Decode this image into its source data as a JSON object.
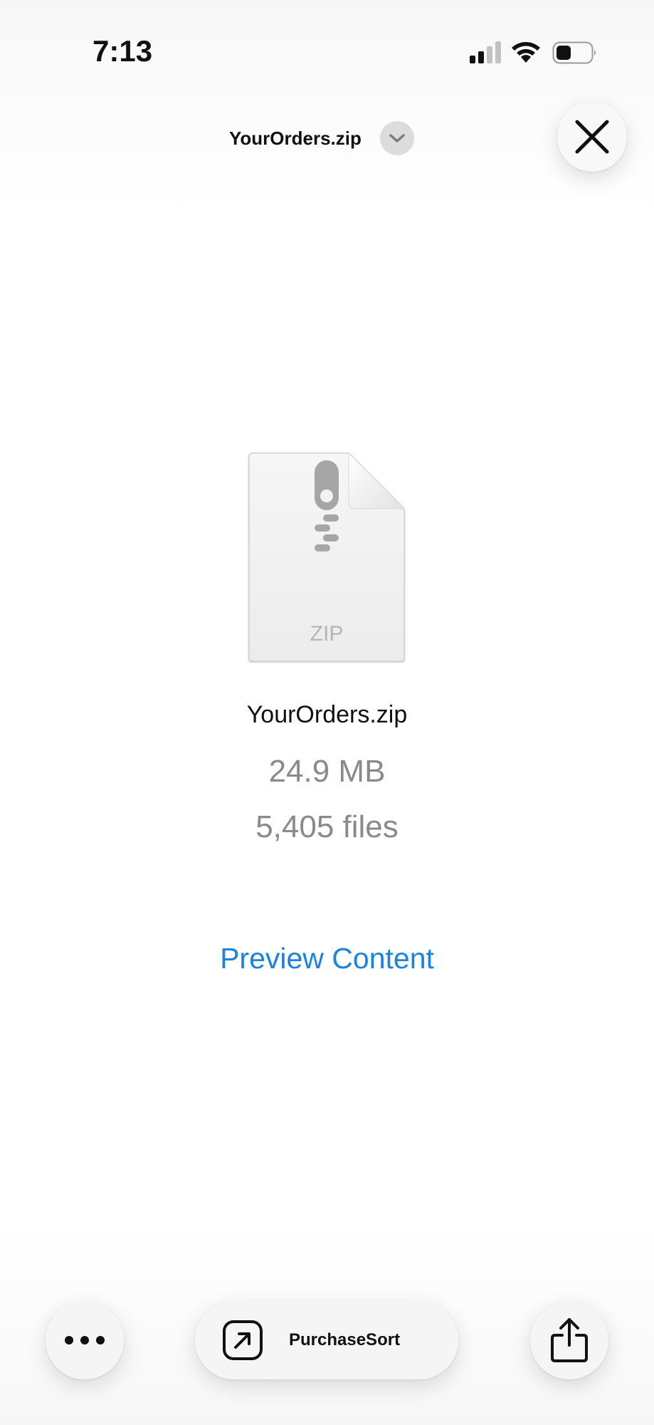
{
  "status_bar": {
    "time": "7:13",
    "icons": [
      "cellular-signal-icon",
      "wifi-icon",
      "battery-icon"
    ]
  },
  "header": {
    "title": "YourOrders.zip",
    "chevron_icon": "chevron-down-icon",
    "close_icon": "close-icon"
  },
  "file": {
    "icon": "zip-file-icon",
    "icon_label": "ZIP",
    "name": "YourOrders.zip",
    "size": "24.9 MB",
    "count": "5,405 files"
  },
  "actions": {
    "preview_label": "Preview Content"
  },
  "toolbar": {
    "more_icon": "more-icon",
    "open_in_app_label": "PurchaseSort",
    "open_in_app_icon": "open-in-app-icon",
    "share_icon": "share-icon"
  },
  "colors": {
    "accent": "#1a82e2",
    "secondary_text": "#8a8a8a",
    "primary_text": "#111111"
  }
}
